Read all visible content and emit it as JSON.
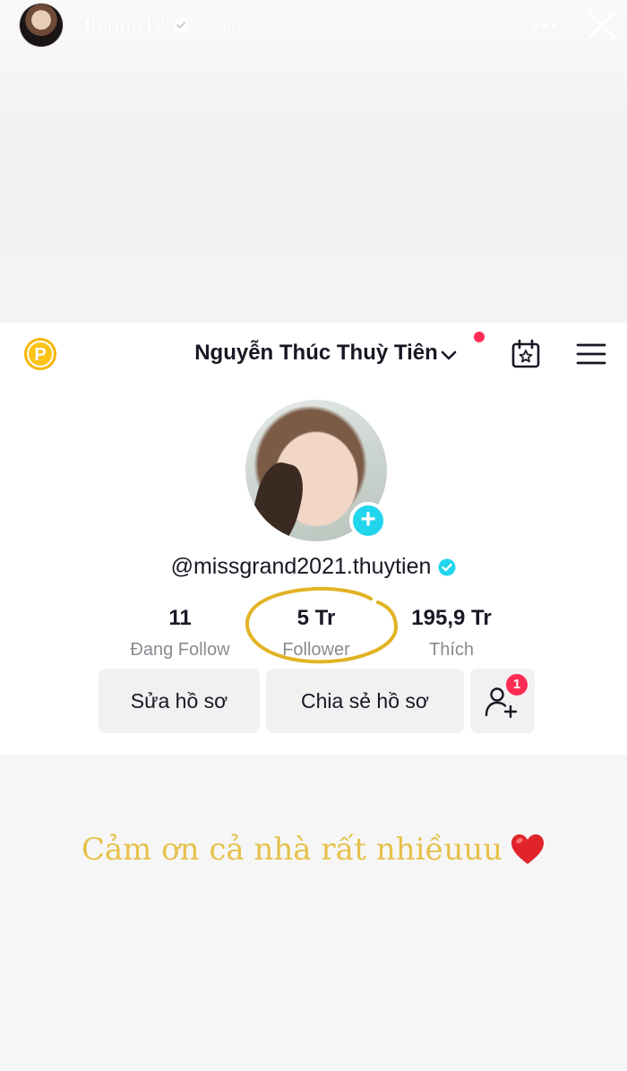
{
  "story": {
    "username": "tienng12",
    "time": "1 giờ",
    "icons": [
      "story-avatar",
      "verified-icon",
      "more-icon",
      "close-icon"
    ]
  },
  "profile": {
    "name": "Nguyễn Thúc Thuỳ Tiên",
    "handle": "@missgrand2021.thuytien",
    "coin_letter": "P",
    "stats": {
      "following": {
        "value": "11",
        "label": "Đang Follow"
      },
      "followers": {
        "value": "5 Tr",
        "label": "Follower"
      },
      "likes": {
        "value": "195,9 Tr",
        "label": "Thích"
      }
    },
    "buttons": {
      "edit": "Sửa hồ sơ",
      "share": "Chia sẻ hồ sơ",
      "friend_badge": "1"
    },
    "add_badge": "+",
    "icons": [
      "coin-icon",
      "chevron-down-icon",
      "calendar-icon",
      "menu-icon",
      "add-friend-icon"
    ]
  },
  "caption": {
    "text": "Cảm ơn cả nhà rất nhiềuuu",
    "emoji": "heart-icon"
  },
  "colors": {
    "accent_red": "#fe2c55",
    "accent_cyan": "#20d5ec",
    "annotation_gold": "#e2b324",
    "caption_gold": "#e6c14a",
    "heart": "#e0242a"
  }
}
